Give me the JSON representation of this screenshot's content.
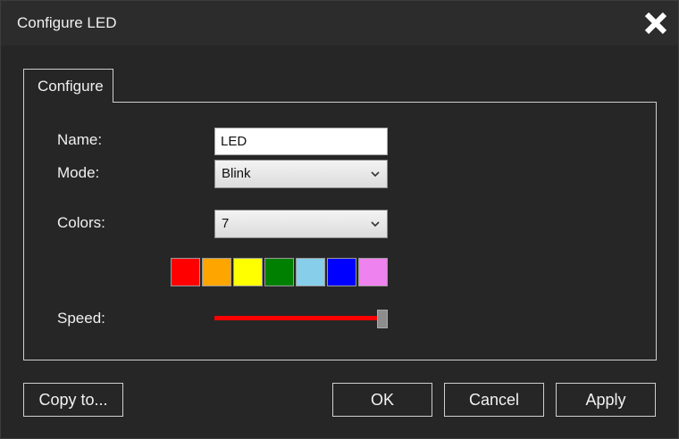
{
  "window": {
    "title": "Configure LED"
  },
  "tabs": [
    {
      "label": "Configure",
      "selected": true
    }
  ],
  "form": {
    "name_label": "Name:",
    "name_value": "LED",
    "mode_label": "Mode:",
    "mode_value": "Blink",
    "colors_label": "Colors:",
    "colors_value": "7",
    "speed_label": "Speed:",
    "speed_level": 1.0
  },
  "swatches": [
    "#ff0000",
    "#ffa500",
    "#ffff00",
    "#008000",
    "#87ceeb",
    "#0000ff",
    "#ee82ee"
  ],
  "colors": {
    "background": "#262626",
    "border": "#cfcfcf",
    "slider_fill": "#ff0000"
  },
  "icons": {
    "close": "close-icon",
    "dropdown": "chevron-down-icon"
  },
  "buttons": {
    "copy_to": "Copy to...",
    "ok": "OK",
    "cancel": "Cancel",
    "apply": "Apply"
  }
}
